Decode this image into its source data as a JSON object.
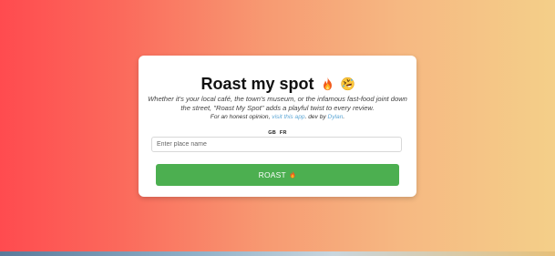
{
  "app": {
    "title": "Roast my spot",
    "title_emojis": [
      "fire-emoji",
      "rolling-laughing-emoji"
    ]
  },
  "intro": {
    "description": "Whether it's your local café, the town's museum, or the infamous fast-food joint down the street, \"Roast My Spot\" adds a playful twist to every review.",
    "honest_prefix": "For an honest opinion,",
    "visit_link": "visit this app",
    "dev_text": ". dev by",
    "dev_link": "Dylan",
    "dev_suffix": "."
  },
  "language": {
    "options": [
      "GB",
      "FR"
    ]
  },
  "search": {
    "placeholder": "Enter place name",
    "value": ""
  },
  "actions": {
    "roast_label": "ROAST",
    "roast_icon": "fire-emoji"
  },
  "colors": {
    "gradient_start": "#ff4b4f",
    "gradient_end": "#f4cf89",
    "button": "#4caf50",
    "link": "#5fa8d6"
  }
}
